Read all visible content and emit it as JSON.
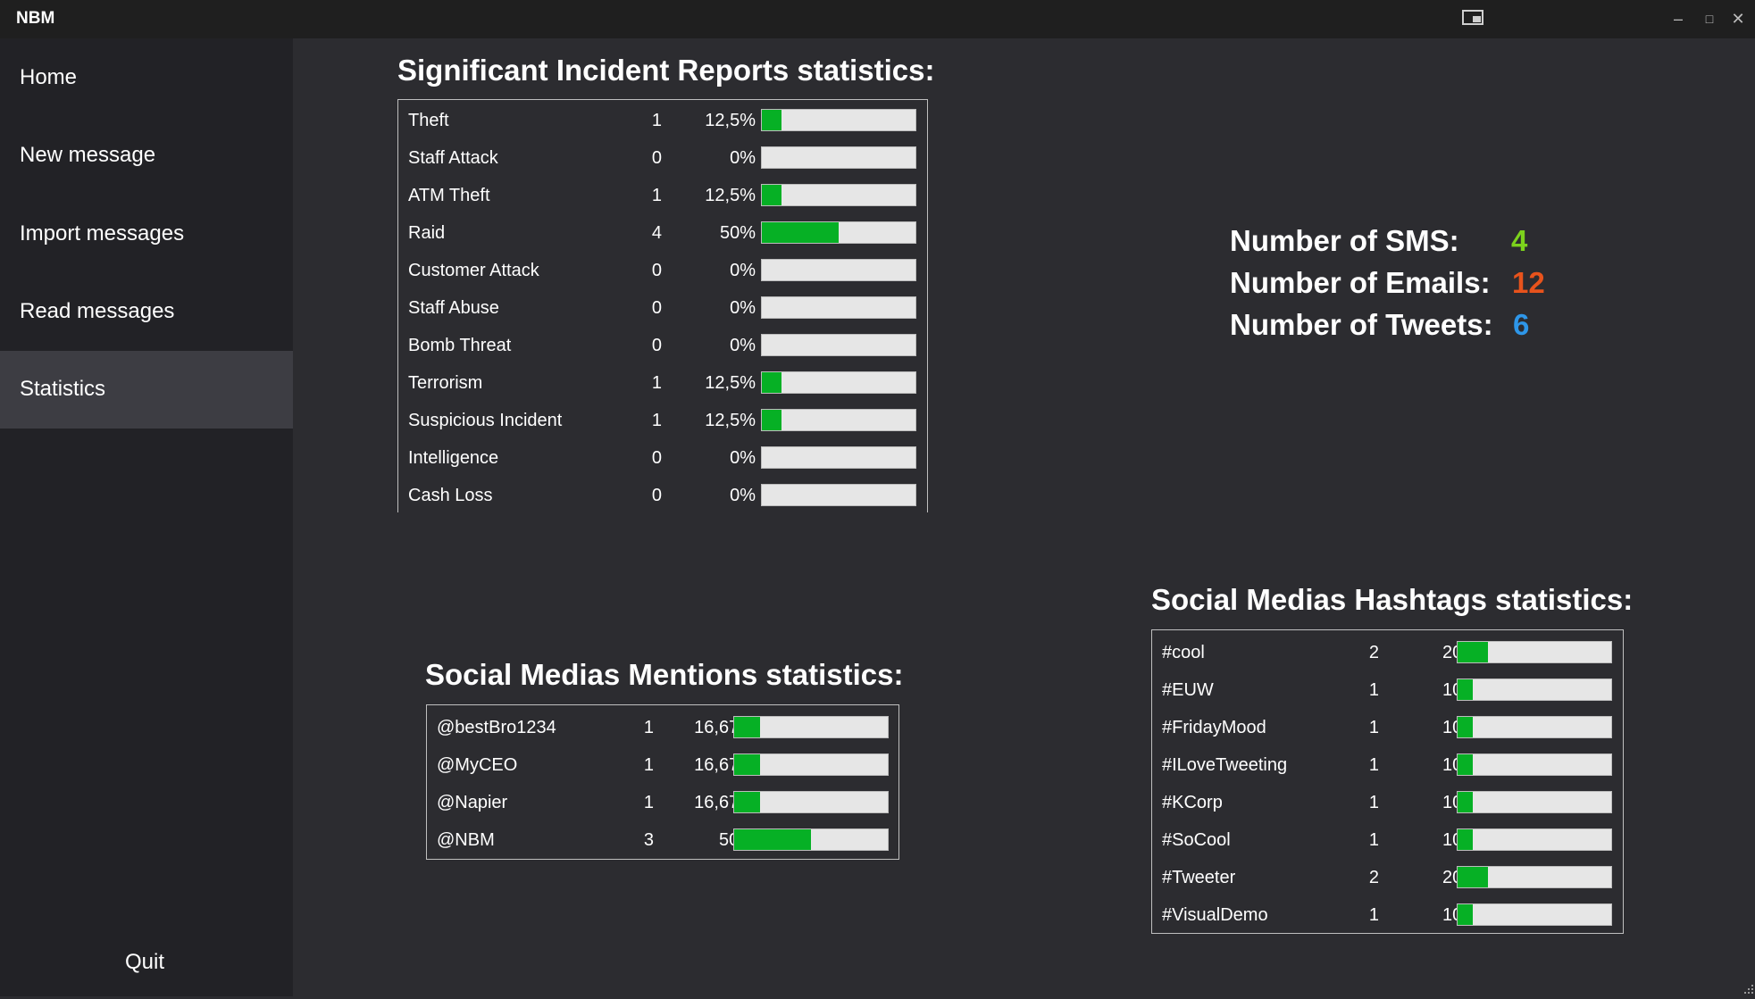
{
  "window": {
    "title": "NBM"
  },
  "sidebar": {
    "items": [
      {
        "label": "Home"
      },
      {
        "label": "New message"
      },
      {
        "label": "Import messages"
      },
      {
        "label": "Read messages"
      },
      {
        "label": "Statistics"
      }
    ],
    "active": "Statistics",
    "quit_label": "Quit"
  },
  "incidents": {
    "title": "Significant Incident Reports statistics:",
    "rows": [
      {
        "label": "Theft",
        "count": "1",
        "percent": "12,5%",
        "fraction": 0.125
      },
      {
        "label": "Staff Attack",
        "count": "0",
        "percent": "0%",
        "fraction": 0
      },
      {
        "label": "ATM Theft",
        "count": "1",
        "percent": "12,5%",
        "fraction": 0.125
      },
      {
        "label": "Raid",
        "count": "4",
        "percent": "50%",
        "fraction": 0.5
      },
      {
        "label": "Customer Attack",
        "count": "0",
        "percent": "0%",
        "fraction": 0
      },
      {
        "label": "Staff Abuse",
        "count": "0",
        "percent": "0%",
        "fraction": 0
      },
      {
        "label": "Bomb Threat",
        "count": "0",
        "percent": "0%",
        "fraction": 0
      },
      {
        "label": "Terrorism",
        "count": "1",
        "percent": "12,5%",
        "fraction": 0.125
      },
      {
        "label": "Suspicious Incident",
        "count": "1",
        "percent": "12,5%",
        "fraction": 0.125
      },
      {
        "label": "Intelligence",
        "count": "0",
        "percent": "0%",
        "fraction": 0
      },
      {
        "label": "Cash Loss",
        "count": "0",
        "percent": "0%",
        "fraction": 0
      }
    ]
  },
  "counts": {
    "sms_label": "Number of SMS:",
    "sms_value": "4",
    "sms_color": "#7cd21c",
    "emails_label": "Number of Emails:",
    "emails_value": "12",
    "emails_color": "#e8531c",
    "tweets_label": "Number of Tweets:",
    "tweets_value": "6",
    "tweets_color": "#2e96e8"
  },
  "mentions": {
    "title": "Social Medias Mentions statistics:",
    "rows": [
      {
        "label": "@bestBro1234",
        "count": "1",
        "percent": "16,67%",
        "fraction": 0.1667
      },
      {
        "label": "@MyCEO",
        "count": "1",
        "percent": "16,67%",
        "fraction": 0.1667
      },
      {
        "label": "@Napier",
        "count": "1",
        "percent": "16,67%",
        "fraction": 0.1667
      },
      {
        "label": "@NBM",
        "count": "3",
        "percent": "50%",
        "fraction": 0.5
      }
    ]
  },
  "hashtags": {
    "title": "Social Medias Hashtags statistics:",
    "rows": [
      {
        "label": "#cool",
        "count": "2",
        "percent": "20%",
        "fraction": 0.2
      },
      {
        "label": "#EUW",
        "count": "1",
        "percent": "10%",
        "fraction": 0.1
      },
      {
        "label": "#FridayMood",
        "count": "1",
        "percent": "10%",
        "fraction": 0.1
      },
      {
        "label": "#ILoveTweeting",
        "count": "1",
        "percent": "10%",
        "fraction": 0.1
      },
      {
        "label": "#KCorp",
        "count": "1",
        "percent": "10%",
        "fraction": 0.1
      },
      {
        "label": "#SoCool",
        "count": "1",
        "percent": "10%",
        "fraction": 0.1
      },
      {
        "label": "#Tweeter",
        "count": "2",
        "percent": "20%",
        "fraction": 0.2
      },
      {
        "label": "#VisualDemo",
        "count": "1",
        "percent": "10%",
        "fraction": 0.1
      }
    ]
  },
  "colors": {
    "bar_fill": "#06b025",
    "bar_track": "#e6e6e6",
    "background": "#2c2c30",
    "sidebar": "#222226"
  },
  "icons": [
    "pip-icon",
    "minimize-icon",
    "maximize-icon",
    "close-icon",
    "resize-grip-icon"
  ]
}
